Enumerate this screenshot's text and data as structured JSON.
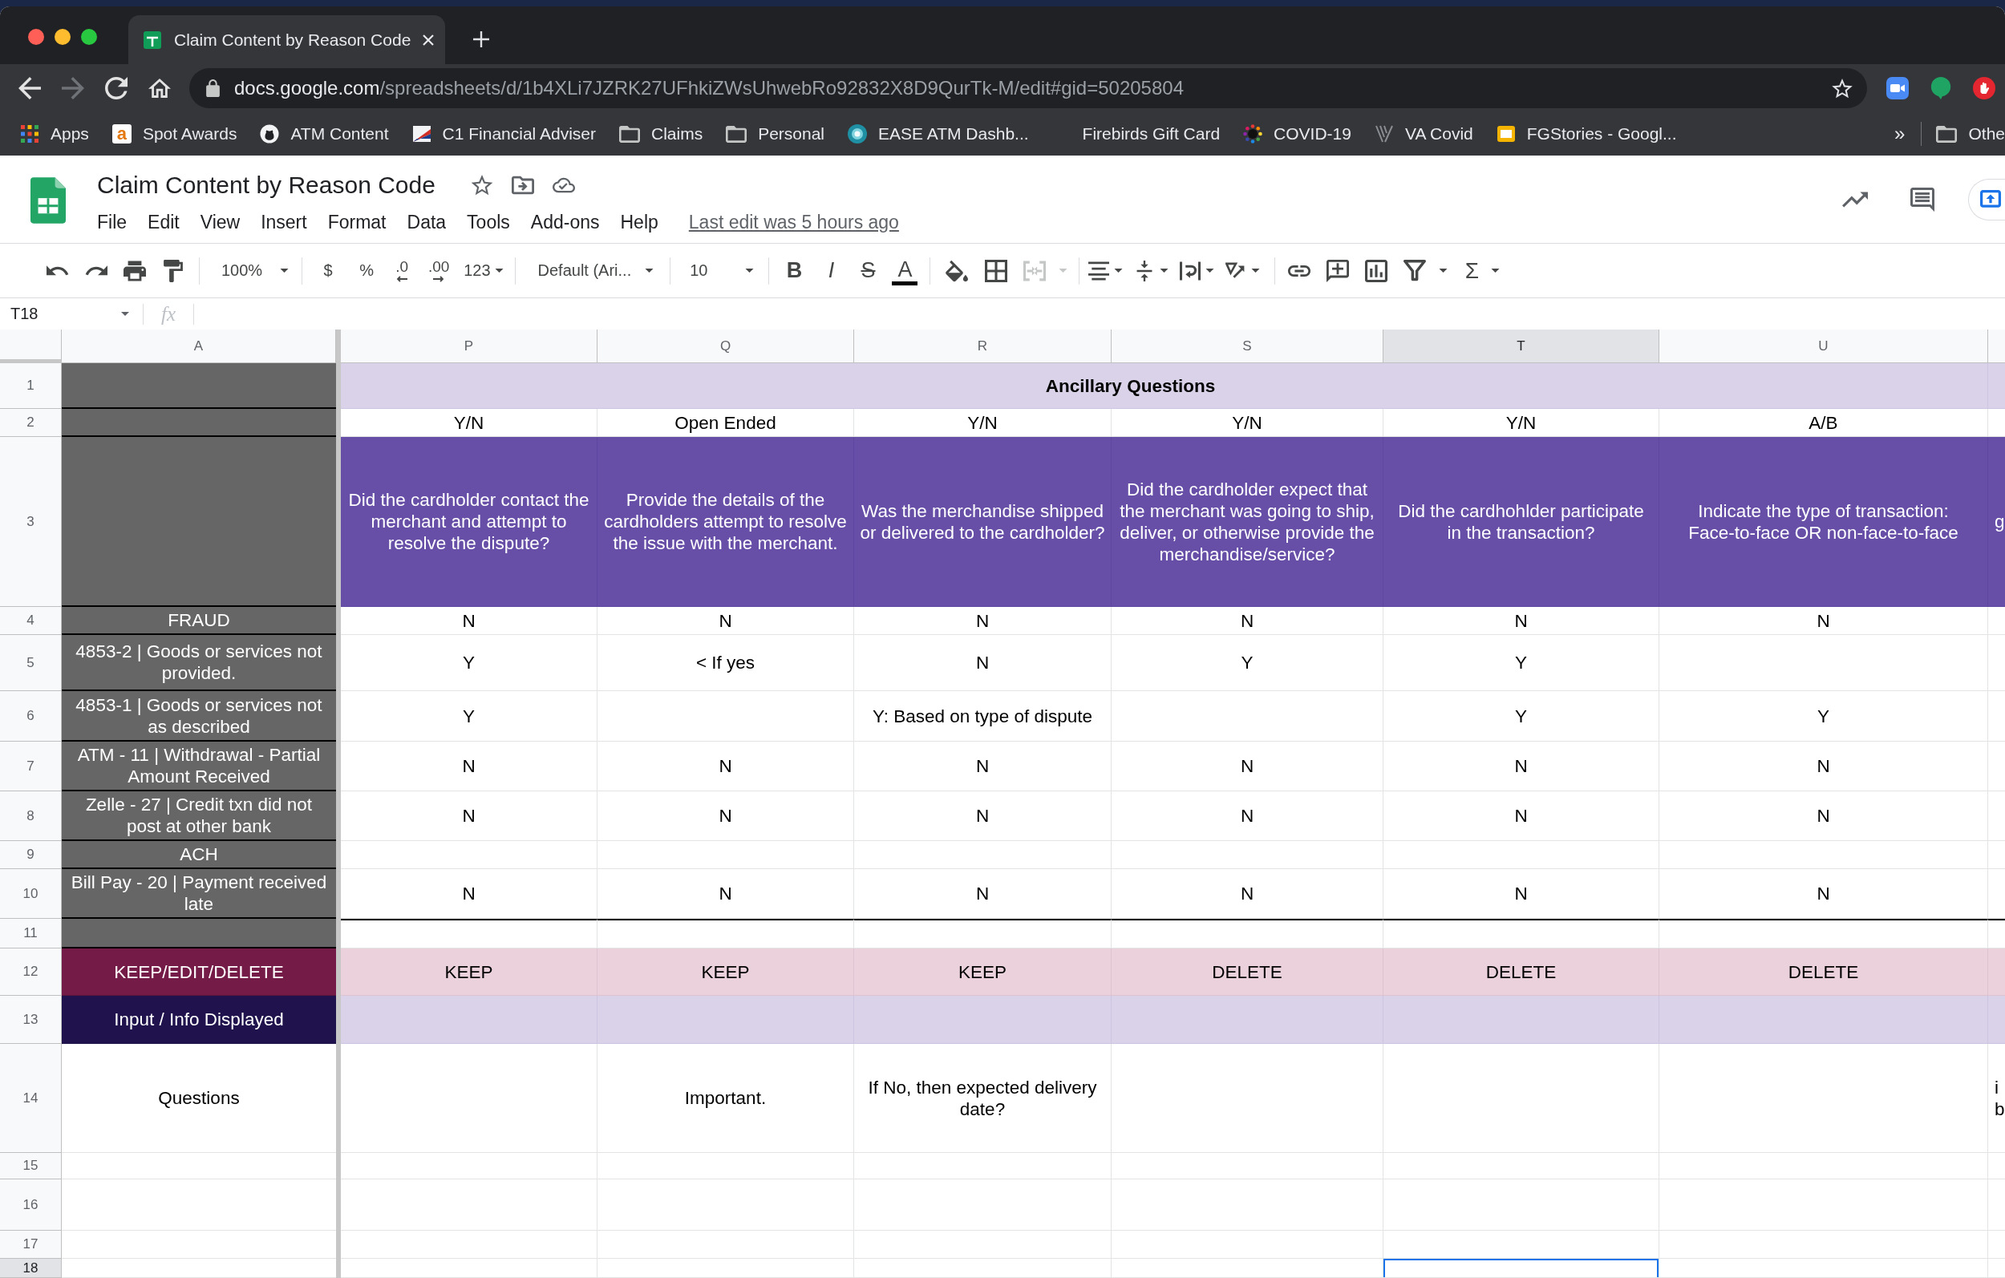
{
  "browser": {
    "tab": {
      "title": "Claim Content by Reason Code",
      "selected": true
    },
    "nav": [
      {
        "kind": "back",
        "disabled": false
      },
      {
        "kind": "forward",
        "disabled": true
      },
      {
        "kind": "reload",
        "disabled": false
      },
      {
        "kind": "home",
        "disabled": false
      }
    ],
    "url": {
      "host": "docs.google.com",
      "path": "/spreadsheets/d/1b4XLi7JZRK27UFhkiZWsUhwebRo92832X8D9QurTk-M/edit#gid=50205804"
    },
    "bookmarks": [
      {
        "label": "Apps",
        "kind": "apps"
      },
      {
        "label": "Spot Awards",
        "kind": "page",
        "favicon_letter": "a"
      },
      {
        "label": "ATM Content",
        "kind": "page"
      },
      {
        "label": "C1 Financial Adviser",
        "kind": "page"
      },
      {
        "label": "Claims",
        "kind": "folder"
      },
      {
        "label": "Personal",
        "kind": "folder"
      },
      {
        "label": "EASE ATM Dashb...",
        "kind": "page"
      },
      {
        "label": "Firebirds Gift Card",
        "kind": "page"
      },
      {
        "label": "COVID-19",
        "kind": "page"
      },
      {
        "label": "VA Covid",
        "kind": "page"
      },
      {
        "label": "FGStories - Googl...",
        "kind": "page"
      }
    ],
    "bookmarks_more": "»",
    "other_bookmarks": {
      "label": "Othe",
      "kind": "folder"
    }
  },
  "doc": {
    "title": "Claim Content by Reason Code",
    "menus": [
      "File",
      "Edit",
      "View",
      "Insert",
      "Format",
      "Data",
      "Tools",
      "Add-ons",
      "Help"
    ],
    "last_edit": "Last edit was 5 hours ago"
  },
  "toolbar": {
    "zoom": "100%",
    "currency": "$",
    "percent": "%",
    "decrease_decimals": ".0",
    "increase_decimals": ".00",
    "more_formats": "123",
    "font": "Default (Ari...",
    "font_size": "10",
    "bold": "B",
    "italic": "I",
    "strikethrough": "S",
    "text_color": "A",
    "merge": {
      "disabled": true
    },
    "functions": "Σ"
  },
  "formula_bar": {
    "cell": "T18",
    "fx_label": "fx"
  },
  "grid": {
    "columns": [
      {
        "label": "A",
        "selected": false
      },
      {
        "label": "P",
        "selected": false
      },
      {
        "label": "Q",
        "selected": false
      },
      {
        "label": "R",
        "selected": false
      },
      {
        "label": "S",
        "selected": false
      },
      {
        "label": "T",
        "selected": true
      },
      {
        "label": "U",
        "selected": false
      },
      {
        "selected": false
      }
    ],
    "rows": [
      {
        "number": "1",
        "selected": false,
        "kind": "banner",
        "banner": "Ancillary Questions"
      },
      {
        "number": "2",
        "selected": false,
        "kind": "answer_type",
        "cells": [
          "Y/N",
          "Open Ended",
          "Y/N",
          "Y/N",
          "Y/N",
          "A/B",
          null
        ]
      },
      {
        "number": "3",
        "selected": false,
        "kind": "question",
        "cells": [
          "Did the cardholder contact the merchant and attempt to resolve the dispute?",
          "Provide the details of the cardholders attempt to resolve the issue with the merchant.",
          "Was the merchandise shipped or delivered to the cardholder?",
          "Did the cardholder expect that the merchant was going to ship, deliver, or otherwise provide the merchandise/service?",
          "Did the cardhohlder participate\nin the transaction?",
          "Indicate the type of transaction:\nFace-to-face OR non-face-to-face",
          "g"
        ]
      },
      {
        "number": "4",
        "selected": false,
        "kind": "reason",
        "label": "FRAUD",
        "cells": [
          "N",
          "N",
          "N",
          "N",
          "N",
          "N",
          null
        ]
      },
      {
        "number": "5",
        "selected": false,
        "kind": "reason",
        "label": "4853-2 | Goods or services not provided.",
        "cells": [
          "Y",
          "< If yes",
          "N",
          "Y",
          "Y",
          null,
          null
        ]
      },
      {
        "number": "6",
        "selected": false,
        "kind": "reason",
        "label": "4853-1 | Goods or services not as described",
        "cells": [
          "Y",
          null,
          "Y: Based on type of dispute",
          null,
          "Y",
          "Y",
          null
        ]
      },
      {
        "number": "7",
        "selected": false,
        "kind": "reason",
        "label": "ATM - 11 | Withdrawal - Partial Amount Received",
        "cells": [
          "N",
          "N",
          "N",
          "N",
          "N",
          "N",
          null
        ]
      },
      {
        "number": "8",
        "selected": false,
        "kind": "reason",
        "label": "Zelle - 27 | Credit txn did not post at other bank",
        "cells": [
          "N",
          "N",
          "N",
          "N",
          "N",
          "N",
          null
        ]
      },
      {
        "number": "9",
        "selected": false,
        "kind": "reason",
        "label": "ACH"
      },
      {
        "number": "10",
        "selected": false,
        "kind": "reason",
        "label": "Bill Pay - 20 | Payment received late",
        "cells": [
          "N",
          "N",
          "N",
          "N",
          "N",
          "N",
          null
        ]
      },
      {
        "number": "11",
        "selected": false,
        "kind": "separator"
      },
      {
        "number": "12",
        "selected": false,
        "kind": "action",
        "label": "KEEP/EDIT/DELETE",
        "cells": [
          "KEEP",
          "KEEP",
          "KEEP",
          "DELETE",
          "DELETE",
          "DELETE",
          null
        ]
      },
      {
        "number": "13",
        "selected": false,
        "kind": "info",
        "label": "Input / Info Displayed"
      },
      {
        "number": "14",
        "selected": false,
        "kind": "prompt",
        "label": "Questions",
        "cells": [
          null,
          "Important.",
          "If No, then expected delivery date?",
          null,
          null,
          null,
          "i b"
        ]
      },
      {
        "number": "15",
        "selected": false,
        "kind": "empty"
      },
      {
        "number": "16",
        "selected": false,
        "kind": "empty"
      },
      {
        "number": "17",
        "selected": false,
        "kind": "empty"
      },
      {
        "number": "18",
        "selected": true,
        "kind": "empty"
      }
    ]
  }
}
